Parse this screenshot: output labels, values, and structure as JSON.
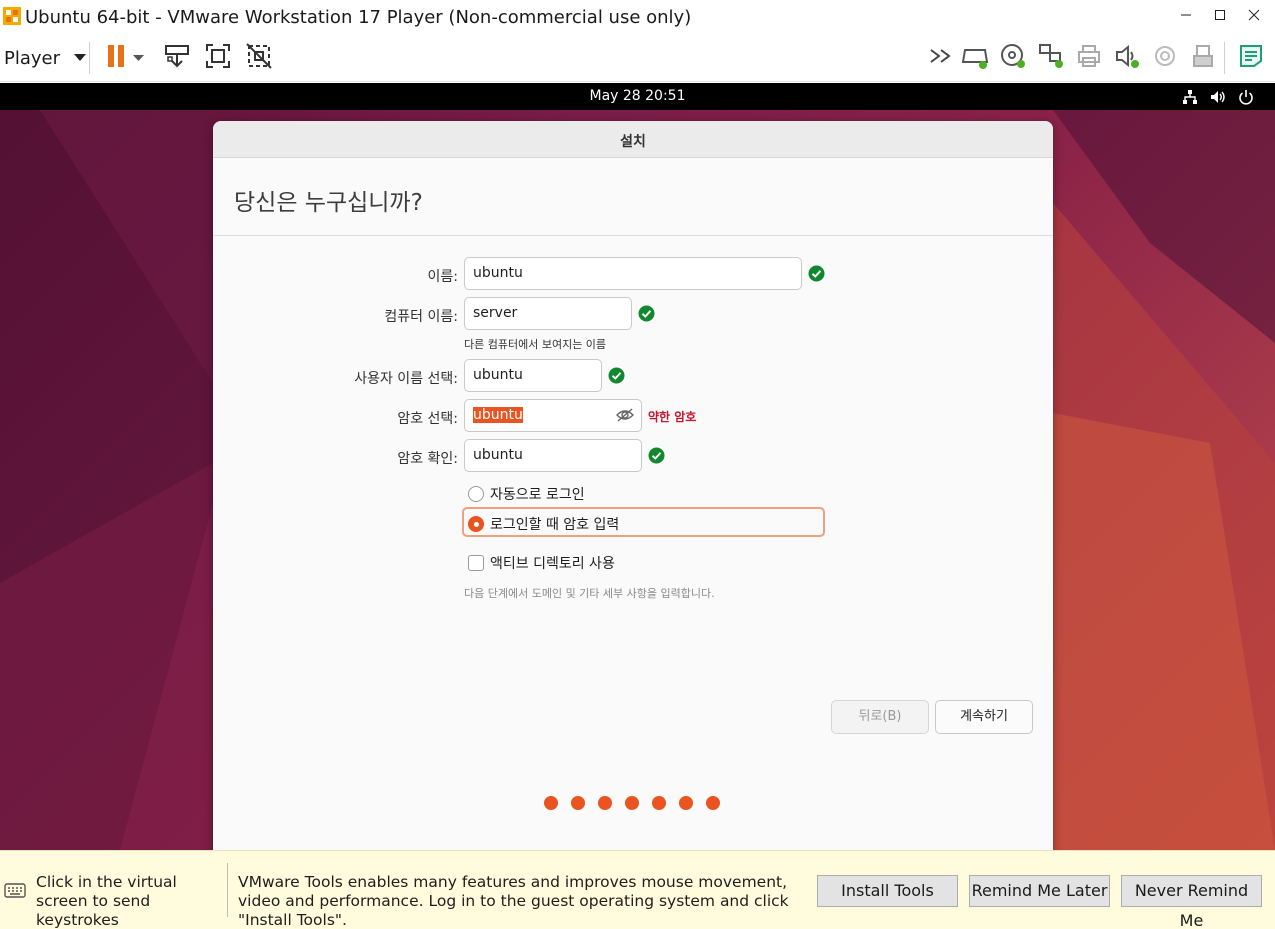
{
  "window": {
    "title": "Ubuntu 64-bit - VMware Workstation 17 Player (Non-commercial use only)",
    "controls": [
      "minimize-icon",
      "maximize-icon",
      "close-icon"
    ]
  },
  "toolbar": {
    "player_label": "Player",
    "icons_left": [
      "pause-icon",
      "dropdown-arrow-icon",
      "send-ctrl-alt-del-icon",
      "fullscreen-icon",
      "unity-icon"
    ],
    "icons_right": [
      "more-chevron-icon",
      "hard-disk-icon",
      "cd-dvd-icon",
      "network-adapter-icon",
      "printer-icon",
      "sound-card-icon",
      "camera-icon",
      "usb-icon",
      "message-log-icon"
    ]
  },
  "guest": {
    "clock": "May 28  20:51",
    "status_icons": [
      "network-icon",
      "volume-icon",
      "power-icon"
    ]
  },
  "installer": {
    "window_title": "설치",
    "heading": "당신은 누구십니까?",
    "fields": {
      "name": {
        "label": "이름:",
        "value": "ubuntu"
      },
      "computer": {
        "label": "컴퓨터 이름:",
        "value": "server",
        "hint": "다른 컴퓨터에서 보여지는 이름"
      },
      "username": {
        "label": "사용자 이름 선택:",
        "value": "ubuntu"
      },
      "password": {
        "label": "암호 선택:",
        "value": "ubuntu",
        "strength": "약한 암호"
      },
      "confirm": {
        "label": "암호 확인:",
        "value": "ubuntu"
      }
    },
    "login_options": [
      {
        "label": "자동으로 로그인",
        "selected": false
      },
      {
        "label": "로그인할 때 암호 입력",
        "selected": true
      }
    ],
    "active_directory": {
      "label": "액티브 디렉토리 사용",
      "checked": false,
      "note": "다음 단계에서 도메인 및 기타 세부 사항을 입력합니다."
    },
    "back_button": "뒤로(B)",
    "continue_button": "계속하기",
    "progress_steps": 7,
    "accent_color": "#e95420"
  },
  "notification": {
    "left_text": "Click in the virtual screen to send keystrokes",
    "message": "VMware Tools enables many features and improves mouse movement, video and performance. Log in to the guest operating system and click \"Install Tools\".",
    "install_button": "Install Tools",
    "remind_button": "Remind Me Later",
    "never_button": "Never Remind Me"
  }
}
